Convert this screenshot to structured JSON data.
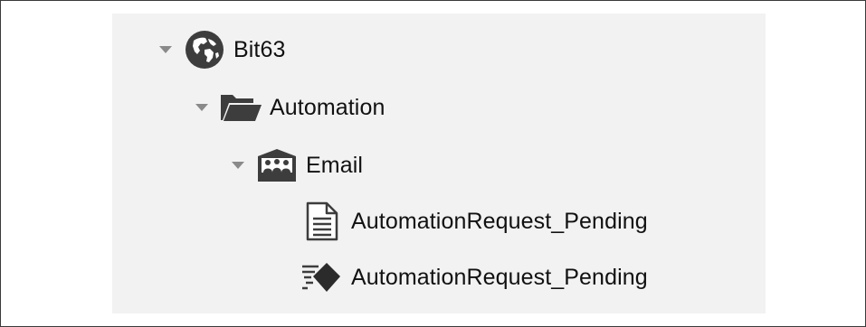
{
  "tree": {
    "nodes": [
      {
        "label": "Bit63",
        "icon": "globe-icon",
        "expanded": true,
        "level": 0
      },
      {
        "label": "Automation",
        "icon": "folder-open-icon",
        "expanded": true,
        "level": 1
      },
      {
        "label": "Email",
        "icon": "email-group-icon",
        "expanded": true,
        "level": 2
      },
      {
        "label": "AutomationRequest_Pending",
        "icon": "document-icon",
        "level": 3
      },
      {
        "label": "AutomationRequest_Pending",
        "icon": "event-diamond-icon",
        "level": 3
      }
    ]
  },
  "colors": {
    "panel_background": "#f2f2f2",
    "icon_dark": "#3d3d3d",
    "disclosure_gray": "#8a8a8a",
    "frame_border": "#3a3a3a"
  }
}
